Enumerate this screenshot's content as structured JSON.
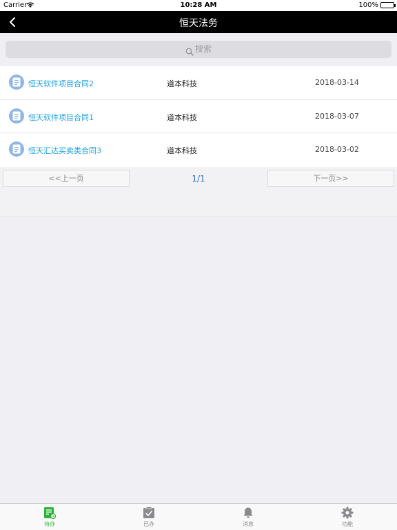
{
  "status_bar": {
    "carrier": "Carrier",
    "time": "10:28 AM",
    "battery": "100%"
  },
  "nav": {
    "title": "恒天法务"
  },
  "search": {
    "placeholder": "搜索"
  },
  "list": [
    {
      "name": "恒天软件项目合同2",
      "company": "道本科技",
      "date": "2018-03-14"
    },
    {
      "name": "恒天软件项目合同1",
      "company": "道本科技",
      "date": "2018-03-07"
    },
    {
      "name": "恒天汇达买卖类合同3",
      "company": "道本科技",
      "date": "2018-03-02"
    }
  ],
  "pager": {
    "prev": "<<上一页",
    "page": "1/1",
    "next": "下一页>>"
  },
  "tabs": [
    {
      "label": "待办",
      "icon": "todo-icon"
    },
    {
      "label": "已办",
      "icon": "done-icon"
    },
    {
      "label": "消息",
      "icon": "bell-icon"
    },
    {
      "label": "功能",
      "icon": "gear-icon"
    }
  ],
  "colors": {
    "active_tab": "#2db33a",
    "link": "#1aa3e0",
    "nav_bg": "#000000"
  }
}
